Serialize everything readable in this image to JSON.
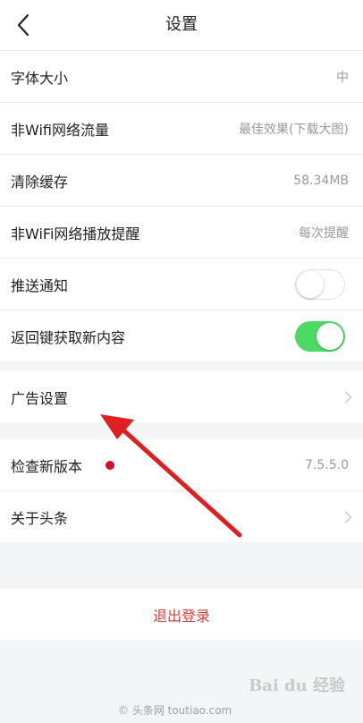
{
  "header": {
    "title": "设置"
  },
  "settings": {
    "font_size": {
      "label": "字体大小",
      "value": "中"
    },
    "non_wifi_traffic": {
      "label": "非Wifi网络流量",
      "value": "最佳效果(下载大图)"
    },
    "clear_cache": {
      "label": "清除缓存",
      "value": "58.34MB"
    },
    "non_wifi_play_reminder": {
      "label": "非WiFi网络播放提醒",
      "value": "每次提醒"
    },
    "push_notification": {
      "label": "推送通知",
      "enabled": false
    },
    "back_refresh": {
      "label": "返回键获取新内容",
      "enabled": true
    }
  },
  "ads": {
    "label": "广告设置"
  },
  "about": {
    "check_update": {
      "label": "检查新版本",
      "value": "7.5.5.0"
    },
    "about_toutiao": {
      "label": "关于头条"
    }
  },
  "logout": {
    "label": "退出登录"
  },
  "watermark": {
    "footer": "© 头条网 toutiao.com",
    "brand": "Bai du 经验"
  },
  "colors": {
    "toggle_on": "#4cd964",
    "logout_text": "#d34040",
    "update_dot": "#d40e25",
    "annotation_arrow": "#e02020"
  }
}
